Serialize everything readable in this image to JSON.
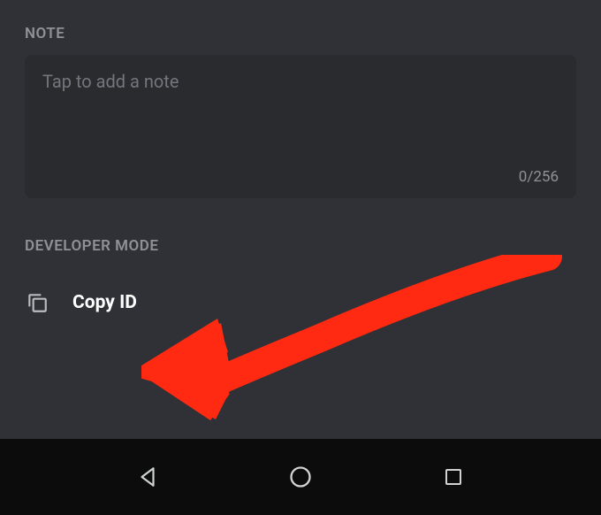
{
  "note_section": {
    "header": "NOTE",
    "placeholder": "Tap to add a note",
    "counter": "0/256"
  },
  "developer_section": {
    "header": "DEVELOPER MODE",
    "copy_id_label": "Copy ID"
  },
  "colors": {
    "background": "#2f3136",
    "panel": "#292b2f",
    "navbar": "#0c0c0c",
    "arrow": "#ff2a11",
    "text_muted": "#8e9297",
    "text_white": "#ffffff"
  }
}
